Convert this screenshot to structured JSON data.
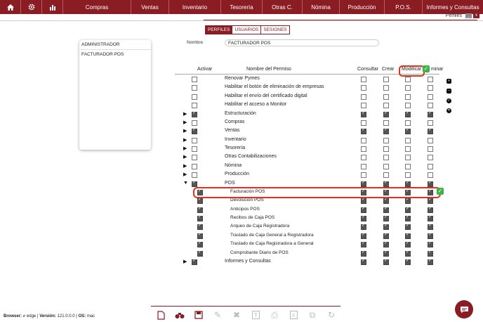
{
  "topbar": {
    "home_icon": "home-icon",
    "settings_icon": "gear-icon",
    "reports_icon": "bar-chart-icon",
    "menu": [
      "Compras",
      "Ventas",
      "Inventario",
      "Tesorería",
      "Otras C.",
      "Nómina",
      "Producción",
      "P.O.S.",
      "Informes y Consultas"
    ]
  },
  "window": {
    "title": "Perfiles",
    "minimize_label": "_",
    "close_label": "x"
  },
  "tabs": [
    "PERFILES",
    "USUARIOS",
    "SESIONES"
  ],
  "profiles": [
    "ADMINISTRADOR",
    "FACTURADOR POS"
  ],
  "form": {
    "name_label": "Nombre",
    "name_value": "FACTURADOR POS"
  },
  "headers": {
    "activar": "Activar",
    "permiso": "Nombre del Permiso",
    "consultar": "Consultar",
    "crear": "Crear",
    "modificar": "Modificar",
    "eliminar": "minar"
  },
  "permissions": [
    {
      "name": "Renovar Pymes",
      "arrow": "",
      "sub": false,
      "checks": [
        false,
        false,
        false,
        false,
        false
      ]
    },
    {
      "name": "Habilitar el botón de eliminación de empresas",
      "arrow": "",
      "sub": false,
      "checks": [
        false,
        false,
        false,
        false,
        false
      ]
    },
    {
      "name": "Habilitar el envío del certificado digital",
      "arrow": "",
      "sub": false,
      "checks": [
        false,
        false,
        false,
        false,
        false
      ]
    },
    {
      "name": "Habilitar el acceso a Monitor",
      "arrow": "",
      "sub": false,
      "checks": [
        false,
        false,
        false,
        false,
        false
      ]
    },
    {
      "name": "Estructuración",
      "arrow": "▶",
      "sub": false,
      "checks": [
        true,
        true,
        true,
        true,
        true
      ]
    },
    {
      "name": "Compras",
      "arrow": "▶",
      "sub": false,
      "checks": [
        false,
        false,
        false,
        false,
        false
      ]
    },
    {
      "name": "Ventas",
      "arrow": "▶",
      "sub": false,
      "checks": [
        true,
        true,
        true,
        true,
        true
      ]
    },
    {
      "name": "Inventario",
      "arrow": "▶",
      "sub": false,
      "checks": [
        false,
        false,
        false,
        false,
        false
      ]
    },
    {
      "name": "Tesorería",
      "arrow": "▶",
      "sub": false,
      "checks": [
        false,
        false,
        false,
        false,
        false
      ]
    },
    {
      "name": "Otras Contabilizaciones",
      "arrow": "▶",
      "sub": false,
      "checks": [
        false,
        false,
        false,
        false,
        false
      ]
    },
    {
      "name": "Nómina",
      "arrow": "▶",
      "sub": false,
      "checks": [
        false,
        false,
        false,
        false,
        false
      ]
    },
    {
      "name": "Producción",
      "arrow": "▶",
      "sub": false,
      "checks": [
        false,
        false,
        false,
        false,
        false
      ]
    },
    {
      "name": "POS",
      "arrow": "▼",
      "sub": false,
      "checks": [
        true,
        true,
        true,
        true,
        true
      ]
    },
    {
      "name": "Facturación POS",
      "arrow": "",
      "sub": true,
      "checks": [
        true,
        true,
        true,
        true,
        true
      ]
    },
    {
      "name": "Devolución POS",
      "arrow": "",
      "sub": true,
      "checks": [
        true,
        true,
        true,
        true,
        true
      ]
    },
    {
      "name": "Anticipos POS",
      "arrow": "",
      "sub": true,
      "checks": [
        true,
        true,
        true,
        true,
        true
      ]
    },
    {
      "name": "Recibos de Caja POS",
      "arrow": "",
      "sub": true,
      "checks": [
        true,
        true,
        true,
        true,
        true
      ]
    },
    {
      "name": "Arqueo de Caja Registradora",
      "arrow": "",
      "sub": true,
      "checks": [
        true,
        true,
        true,
        true,
        true
      ]
    },
    {
      "name": "Traslado de Caja General a Registradora",
      "arrow": "",
      "sub": true,
      "checks": [
        true,
        true,
        true,
        true,
        true
      ]
    },
    {
      "name": "Traslado de Caja Registradora a General",
      "arrow": "",
      "sub": true,
      "checks": [
        true,
        true,
        true,
        true,
        true
      ]
    },
    {
      "name": "Comprobante Diario de POS",
      "arrow": "",
      "sub": true,
      "checks": [
        true,
        true,
        true,
        true,
        true
      ]
    },
    {
      "name": "Informes y Consultas",
      "arrow": "▶",
      "sub": false,
      "checks": [
        true,
        true,
        true,
        true,
        true
      ]
    }
  ],
  "status": {
    "browser_label": "Browser:",
    "browser": "edge",
    "version_label": "Versión:",
    "version": "121.0.0.0",
    "os_label": "OS:",
    "os": "mac"
  },
  "toolbar": [
    "new-icon",
    "search-icon",
    "save-icon",
    "edit-icon",
    "delete-icon",
    "text-icon",
    "print-icon",
    "excel-icon",
    "copy-icon",
    "history-icon"
  ],
  "colors": {
    "brand": "#8a1c24",
    "highlight": "#e0321c",
    "success": "#3bb54a"
  }
}
